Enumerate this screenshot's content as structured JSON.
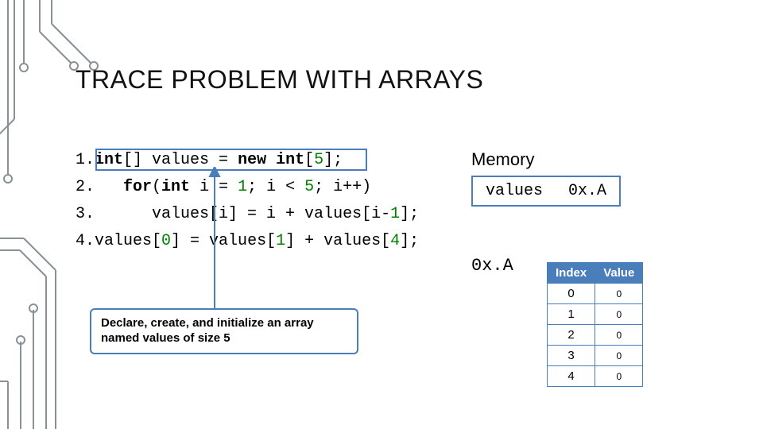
{
  "title": "TRACE PROBLEM WITH ARRAYS",
  "code": {
    "l1n": "1.",
    "l1a": "int",
    "l1b": "[] values = ",
    "l1c": "new int",
    "l1d": "[",
    "l1e": "5",
    "l1f": "];",
    "l2n": "2.",
    "l2a": "   for",
    "l2b": "(",
    "l2c": "int",
    "l2d": " i = ",
    "l2e": "1",
    "l2f": "; i < ",
    "l2g": "5",
    "l2h": "; i++)",
    "l3n": "3.",
    "l3a": "      values[i] = i + values[i-",
    "l3b": "1",
    "l3c": "];",
    "l4n": "4.",
    "l4a": "values[",
    "l4b": "0",
    "l4c": "] = values[",
    "l4d": "1",
    "l4e": "] + values[",
    "l4f": "4",
    "l4g": "];"
  },
  "callout": "Declare, create, and initialize an array named values of size 5",
  "memory": {
    "title": "Memory",
    "varname": "values",
    "varvalue": "0x.A",
    "addr": "0x.A"
  },
  "table": {
    "h1": "Index",
    "h2": "Value",
    "rows": [
      {
        "i": "0",
        "v": "0"
      },
      {
        "i": "1",
        "v": "0"
      },
      {
        "i": "2",
        "v": "0"
      },
      {
        "i": "3",
        "v": "0"
      },
      {
        "i": "4",
        "v": "0"
      }
    ]
  }
}
